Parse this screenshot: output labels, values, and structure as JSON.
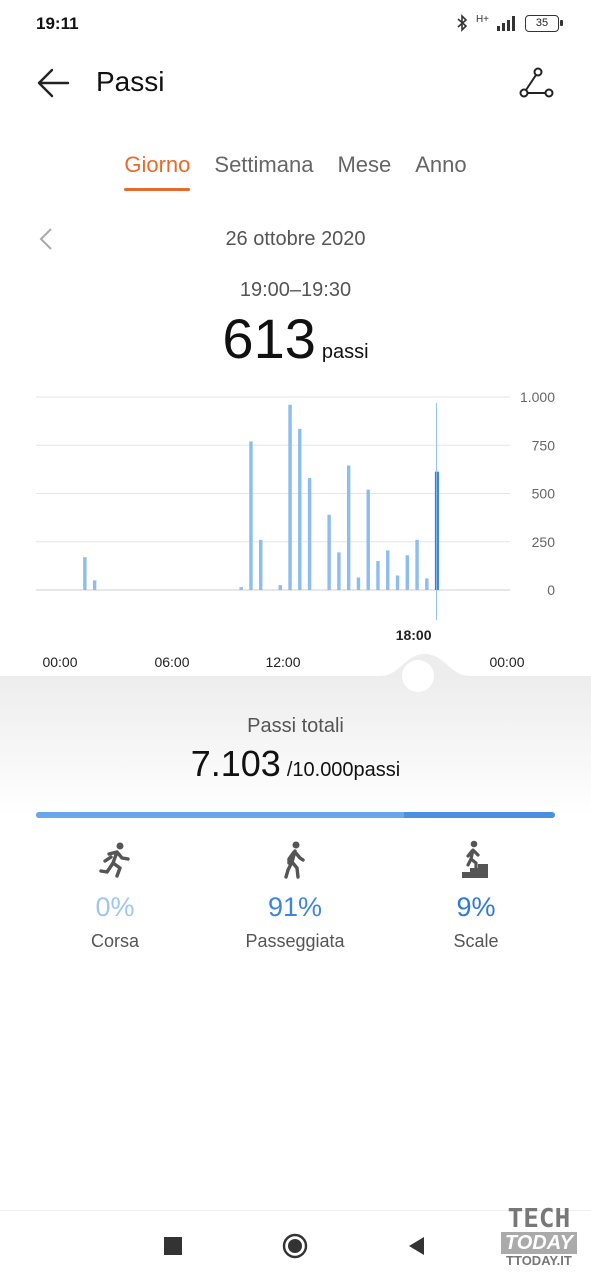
{
  "status_bar": {
    "time": "19:11",
    "network": "H+",
    "battery": "35"
  },
  "header": {
    "title": "Passi"
  },
  "tabs": [
    {
      "label": "Giorno",
      "active": true
    },
    {
      "label": "Settimana",
      "active": false
    },
    {
      "label": "Mese",
      "active": false
    },
    {
      "label": "Anno",
      "active": false
    }
  ],
  "date": "26 ottobre 2020",
  "selection": {
    "range": "19:00–19:30",
    "steps": "613",
    "unit": "passi"
  },
  "chart_data": {
    "type": "bar",
    "x_unit": "hour",
    "xlim": [
      0,
      24
    ],
    "ylim": [
      0,
      1000
    ],
    "y_ticks": [
      "1.000",
      "750",
      "500",
      "250",
      "0"
    ],
    "x_ticks": [
      "00:00",
      "06:00",
      "12:00",
      "18:00",
      "00:00"
    ],
    "selected_label": "18:00",
    "bars": [
      {
        "x": 2.5,
        "value": 170
      },
      {
        "x": 3.0,
        "value": 50
      },
      {
        "x": 10.5,
        "value": 15
      },
      {
        "x": 11.0,
        "value": 770
      },
      {
        "x": 11.5,
        "value": 260
      },
      {
        "x": 12.5,
        "value": 25
      },
      {
        "x": 13.0,
        "value": 960
      },
      {
        "x": 13.5,
        "value": 835
      },
      {
        "x": 14.0,
        "value": 580
      },
      {
        "x": 15.0,
        "value": 390
      },
      {
        "x": 15.5,
        "value": 195
      },
      {
        "x": 16.0,
        "value": 645
      },
      {
        "x": 16.5,
        "value": 65
      },
      {
        "x": 17.0,
        "value": 520
      },
      {
        "x": 17.5,
        "value": 150
      },
      {
        "x": 18.0,
        "value": 205
      },
      {
        "x": 18.5,
        "value": 75
      },
      {
        "x": 19.0,
        "value": 180
      },
      {
        "x": 19.5,
        "value": 260
      },
      {
        "x": 20.0,
        "value": 60
      },
      {
        "x": 20.5,
        "value": 613,
        "selected": true
      }
    ],
    "colors": {
      "bar": "#8cbcf0",
      "selected": "#2f7fe0",
      "grid": "#e6e6e6"
    }
  },
  "totals": {
    "label": "Passi totali",
    "value": "7.103",
    "goal": "/10.000passi",
    "progress": 0.71
  },
  "activities": [
    {
      "icon": "running-icon",
      "pct": "0%",
      "label": "Corsa",
      "color": "#9ec7f2"
    },
    {
      "icon": "walking-icon",
      "pct": "91%",
      "label": "Passeggiata",
      "color": "#3f86db"
    },
    {
      "icon": "stairs-icon",
      "pct": "9%",
      "label": "Scale",
      "color": "#2f7ad8"
    }
  ],
  "watermark": {
    "line1": "TECH",
    "line2": "TODAY",
    "line3": "TTODAY.IT"
  },
  "colors": {
    "accent": "#e86a2b",
    "primary": "#3f86db"
  }
}
